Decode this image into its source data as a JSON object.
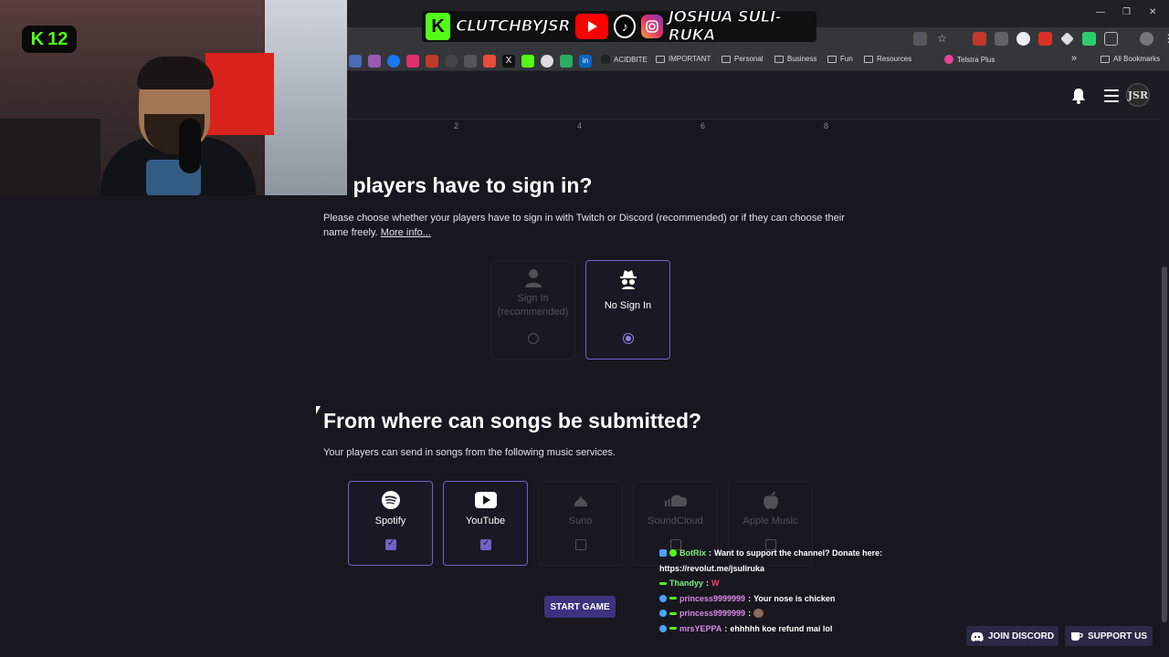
{
  "overlay": {
    "brand_left": "CLUTCHBYJSR",
    "brand_right": "JOSHUA SULI-RUKA",
    "k_badge": "K",
    "cam_badge": {
      "k": "K",
      "num": "12"
    }
  },
  "browser": {
    "bookmarks": [
      {
        "label": "ACIDBITE"
      },
      {
        "label": "IMPORTANT"
      },
      {
        "label": "Personal"
      },
      {
        "label": "Business"
      },
      {
        "label": "Fun"
      },
      {
        "label": "Resources"
      },
      {
        "label": "Telstra Plus"
      },
      {
        "label": "All Bookmarks"
      }
    ],
    "more_label": "»"
  },
  "header": {
    "avatar_text": "JSR"
  },
  "ticks": [
    "2",
    "4",
    "6",
    "8"
  ],
  "sign_in": {
    "title": "o players have to sign in?",
    "description": "Please choose whether your players have to sign in with Twitch or Discord (recommended) or if they can choose their name freely.",
    "more_info": "More info...",
    "options": [
      {
        "label": "Sign In (recommended)",
        "selected": false
      },
      {
        "label": "No Sign In",
        "selected": true
      }
    ]
  },
  "songs": {
    "title": "From where can songs be submitted?",
    "description": "Your players can send in songs from the following music services.",
    "services": [
      {
        "label": "Spotify",
        "checked": true,
        "icon": "spotify-icon"
      },
      {
        "label": "YouTube",
        "checked": true,
        "icon": "youtube-icon"
      },
      {
        "label": "Suno",
        "checked": false,
        "icon": "suno-icon"
      },
      {
        "label": "SoundCloud",
        "checked": false,
        "icon": "soundcloud-icon"
      },
      {
        "label": "Apple Music",
        "checked": false,
        "icon": "apple-icon"
      }
    ]
  },
  "start_button": "START GAME",
  "chat": [
    {
      "user": "BotRix",
      "sep": " : ",
      "msg": "Want to support the channel? Donate here:"
    },
    {
      "user": "",
      "sep": "",
      "msg": "https://revolut.me/jsuliruka"
    },
    {
      "user": "Thandyy",
      "sep": " : ",
      "msg": "W"
    },
    {
      "user": "princess9999999",
      "sep": " : ",
      "msg": "Your nose is chicken"
    },
    {
      "user": "princess9999999",
      "sep": " : ",
      "msg": ""
    },
    {
      "user": "mrsYEPPA",
      "sep": " : ",
      "msg": "ehhhhh koe refund mai lol"
    }
  ],
  "footer": {
    "discord": "JOIN DISCORD",
    "support": "SUPPORT US"
  },
  "colors": {
    "accent": "#6e63c7",
    "background": "#18161f",
    "kick_green": "#53fc18"
  }
}
